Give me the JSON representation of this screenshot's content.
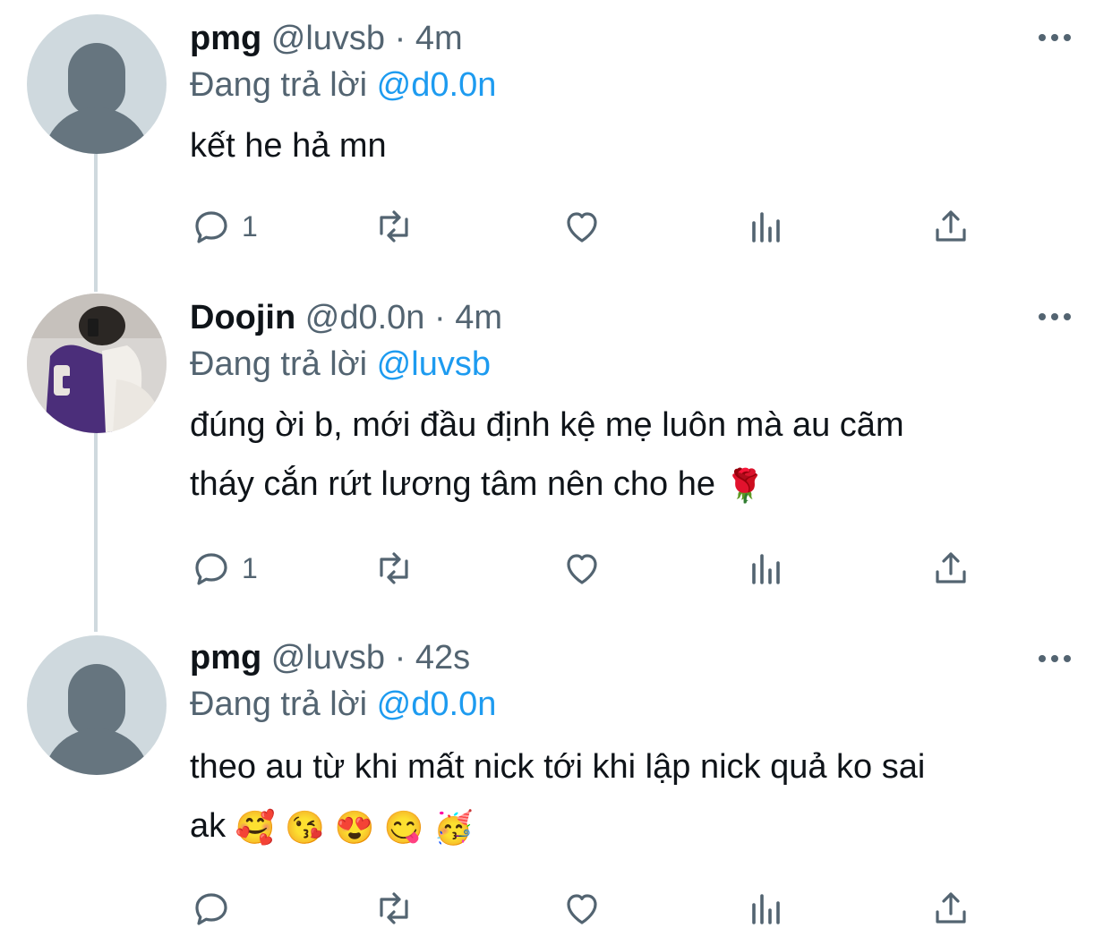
{
  "tweets": [
    {
      "name": "pmg",
      "handle": "@luvsb",
      "time": "4m",
      "reply_prefix": "Đang trả lời",
      "reply_to": "@d0.0n",
      "text_lines": [
        "kết he hả mn"
      ],
      "reply_count": "1",
      "avatar": "default-avatar"
    },
    {
      "name": "Doojin",
      "handle": "@d0.0n",
      "time": "4m",
      "reply_prefix": "Đang trả lời",
      "reply_to": "@luvsb",
      "text_lines": [
        "đúng ời b, mới đầu định kệ mẹ luôn mà au cãm",
        "tháy cắn rứt lương tâm nên cho he"
      ],
      "emoji": "🌹",
      "reply_count": "1",
      "avatar": "photo-avatar"
    },
    {
      "name": "pmg",
      "handle": "@luvsb",
      "time": "42s",
      "reply_prefix": "Đang trả lời",
      "reply_to": "@d0.0n",
      "text_lines": [
        "theo au từ khi mất nick tới khi lập nick quả ko sai",
        "ak"
      ],
      "emojis": [
        "🥰",
        "😘",
        "😍",
        "😋",
        "🥳"
      ],
      "reply_count": "",
      "avatar": "default-avatar"
    }
  ],
  "separator": "·",
  "colors": {
    "link": "#1d9bf0",
    "muted": "#536471",
    "text": "#0f1419",
    "thread_line": "#cfd9de"
  },
  "action_icons": [
    "reply-icon",
    "retweet-icon",
    "like-icon",
    "views-icon",
    "share-icon"
  ]
}
